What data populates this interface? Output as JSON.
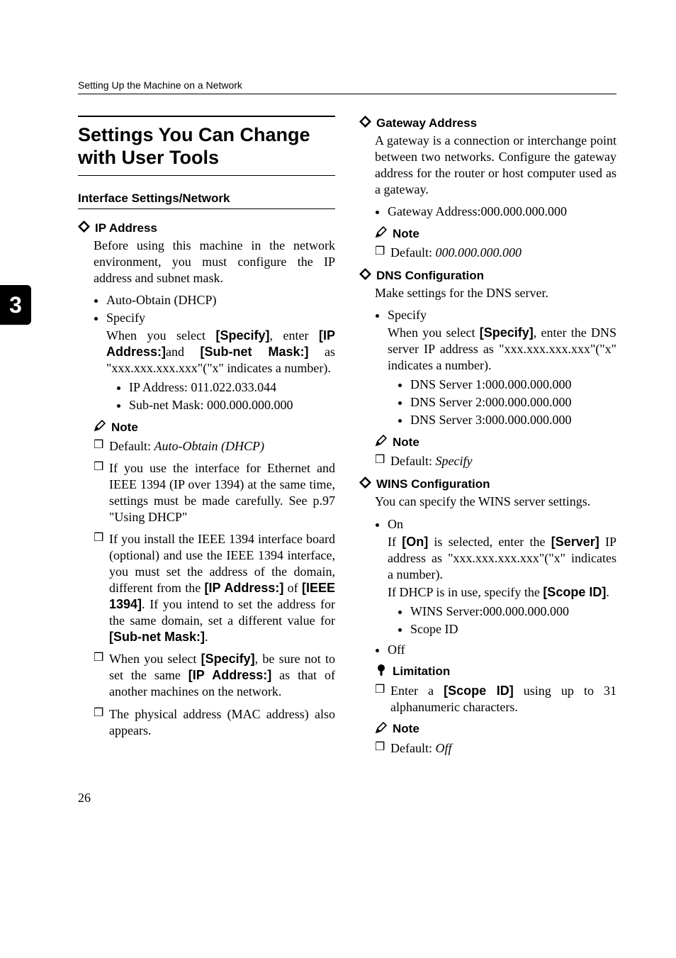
{
  "running_head": "Setting Up the Machine on a Network",
  "chapter_tab": "3",
  "page_number": "26",
  "section_title": "Settings You Can Change with User Tools",
  "subsection": "Interface Settings/Network",
  "ip": {
    "head": "IP Address",
    "intro": "Before using this machine in the network environment, you must configure the IP address and subnet mask.",
    "b1": "Auto-Obtain (DHCP)",
    "b2": "Specify",
    "b2_body_a": "When you select ",
    "b2_body_b": "[Specify]",
    "b2_body_c": ", enter ",
    "b2_body_d": "[IP Address:]",
    "b2_body_e": "and ",
    "b2_body_f": "[Sub-net Mask:]",
    "b2_body_g": " as \"xxx.xxx.xxx.xxx\"(\"x\" indicates a number).",
    "b2_s1": "IP Address: 011.022.033.044",
    "b2_s2": "Sub-net Mask: 000.000.000.000",
    "note_label": "Note",
    "nb1_a": "Default: ",
    "nb1_b": "Auto-Obtain (DHCP)",
    "nb2": "If you use the interface for Ethernet and IEEE 1394 (IP over 1394) at the same time, settings must be made carefully. See p.97 \"Using DHCP\"",
    "nb3_a": "If you install the IEEE 1394 interface board (optional) and use the IEEE 1394 interface, you must set the address of the domain, different from the ",
    "nb3_b": "[IP Address:]",
    "nb3_c": " of ",
    "nb3_d": "[IEEE 1394]",
    "nb3_e": ". If you intend to set the address for the same domain, set a different value for ",
    "nb3_f": "[Sub-net Mask:]",
    "nb3_g": ".",
    "nb4_a": "When you select ",
    "nb4_b": "[Specify]",
    "nb4_c": ", be sure not to set the same ",
    "nb4_d": "[IP Address:]",
    "nb4_e": " as that of another machines on the network.",
    "nb5": "The physical address (MAC address) also appears."
  },
  "gw": {
    "head": "Gateway Address",
    "intro": "A gateway is a connection or interchange point between two networks. Configure the gateway address for the router or host computer used as a gateway.",
    "b1": "Gateway Address:000.000.000.000",
    "note_label": "Note",
    "nb1_a": "Default: ",
    "nb1_b": "000.000.000.000"
  },
  "dns": {
    "head": "DNS Configuration",
    "intro": "Make settings for the DNS server.",
    "b1": "Specify",
    "b1_body_a": "When you select ",
    "b1_body_b": "[Specify]",
    "b1_body_c": ", enter the DNS server IP address as \"xxx.xxx.xxx.xxx\"(\"x\" indicates a number).",
    "s1": "DNS Server 1:000.000.000.000",
    "s2": "DNS Server 2:000.000.000.000",
    "s3": "DNS Server 3:000.000.000.000",
    "note_label": "Note",
    "nb1_a": "Default: ",
    "nb1_b": "Specify"
  },
  "wins": {
    "head": "WINS Configuration",
    "intro": "You can specify the WINS server settings.",
    "b1": "On",
    "b1_body_a": "If ",
    "b1_body_b": "[On]",
    "b1_body_c": " is selected, enter the ",
    "b1_body_d": "[Server]",
    "b1_body_e": " IP address as \"xxx.xxx.xxx.xxx\"(\"x\" indicates a number).",
    "b1_body_f": "If DHCP is in use, specify the ",
    "b1_body_g": "[Scope ID]",
    "b1_body_h": ".",
    "s1": "WINS Server:000.000.000.000",
    "s2": "Scope ID",
    "b2": "Off",
    "limit_label": "Limitation",
    "lb1_a": "Enter a ",
    "lb1_b": "[Scope ID]",
    "lb1_c": " using up to 31 alphanumeric characters.",
    "note_label": "Note",
    "nb1_a": "Default: ",
    "nb1_b": "Off"
  }
}
